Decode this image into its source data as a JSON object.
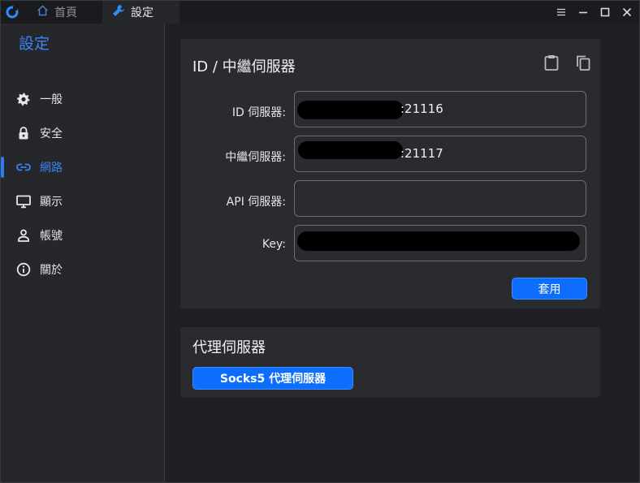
{
  "titlebar": {
    "tabs": [
      {
        "label": "首頁",
        "icon": "home-icon"
      },
      {
        "label": "設定",
        "icon": "wrench-icon"
      }
    ],
    "controls": [
      "menu-icon",
      "minimize-icon",
      "maximize-icon",
      "close-icon"
    ]
  },
  "sidebar": {
    "title": "設定",
    "items": [
      {
        "label": "一般",
        "icon": "gear-icon"
      },
      {
        "label": "安全",
        "icon": "lock-icon"
      },
      {
        "label": "網路",
        "icon": "link-icon",
        "active": true
      },
      {
        "label": "顯示",
        "icon": "monitor-icon"
      },
      {
        "label": "帳號",
        "icon": "person-icon"
      },
      {
        "label": "關於",
        "icon": "info-icon"
      }
    ]
  },
  "relay_card": {
    "title": "ID / 中繼伺服器",
    "icons": [
      "clipboard-icon",
      "copy-icon"
    ],
    "fields": {
      "id_server": {
        "label": "ID 伺服器:",
        "value": ":21116"
      },
      "relay_server": {
        "label": "中繼伺服器:",
        "value": ":21117"
      },
      "api_server": {
        "label": "API 伺服器:",
        "value": ""
      },
      "key": {
        "label": "Key:",
        "value": ""
      }
    },
    "apply_label": "套用"
  },
  "proxy_card": {
    "title": "代理伺服器",
    "socks_label": "Socks5 代理伺服器"
  },
  "colors": {
    "accent": "#0d6efd",
    "active_nav": "#3b82f6",
    "background": "#1f2023",
    "sidebar": "#26272b",
    "card": "#2a2b2f"
  }
}
